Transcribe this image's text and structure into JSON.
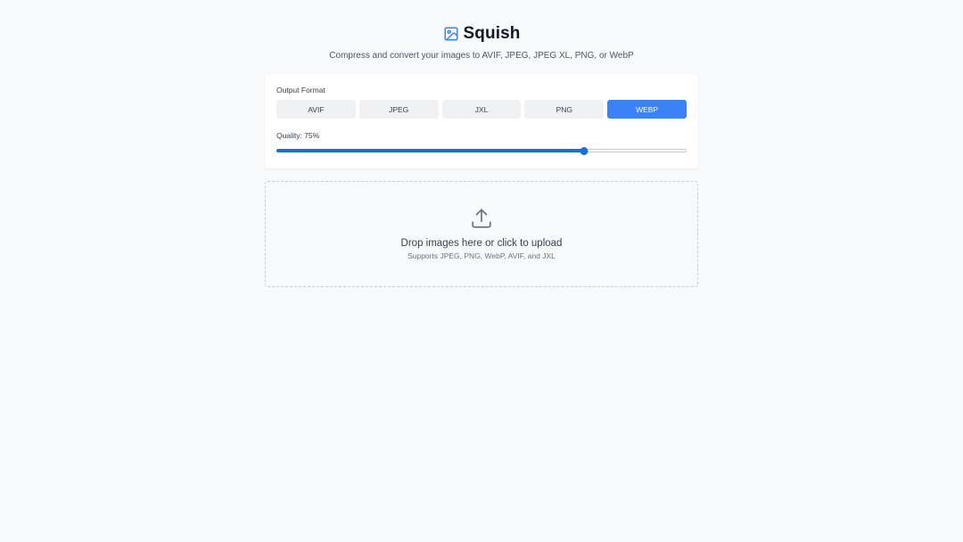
{
  "header": {
    "title": "Squish",
    "icon": "image-icon",
    "subtitle": "Compress and convert your images to AVIF, JPEG, JPEG XL, PNG, or WebP"
  },
  "settings": {
    "format_label": "Output Format",
    "formats": [
      {
        "label": "AVIF",
        "selected": false
      },
      {
        "label": "JPEG",
        "selected": false
      },
      {
        "label": "JXL",
        "selected": false
      },
      {
        "label": "PNG",
        "selected": false
      },
      {
        "label": "WEBP",
        "selected": true
      }
    ],
    "quality_label": "Quality: 75%",
    "quality_value": 75
  },
  "dropzone": {
    "icon": "upload-icon",
    "title": "Drop images here or click to upload",
    "subtitle": "Supports JPEG, PNG, WebP, AVIF, and JXL"
  },
  "colors": {
    "accent": "#3b82f6",
    "slider": "#1a6fe0",
    "background": "#f8f9fb"
  }
}
